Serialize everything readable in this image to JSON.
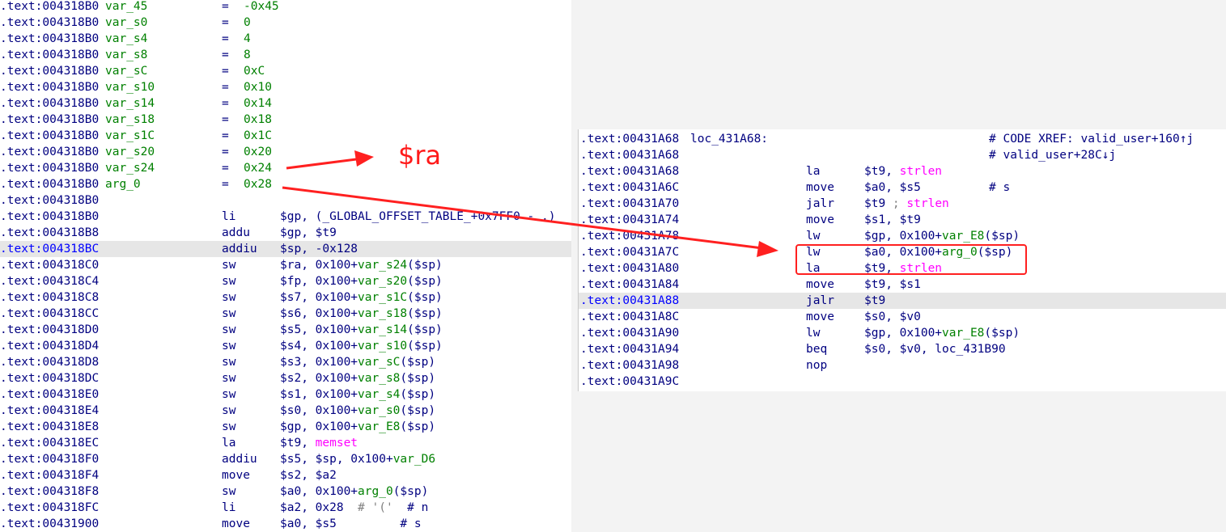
{
  "left": {
    "vars": [
      {
        "addr": ".text:004318B0",
        "name": "var_45",
        "eq": "=",
        "val": "-0x45"
      },
      {
        "addr": ".text:004318B0",
        "name": "var_s0",
        "eq": "=",
        "val": "0"
      },
      {
        "addr": ".text:004318B0",
        "name": "var_s4",
        "eq": "=",
        "val": "4"
      },
      {
        "addr": ".text:004318B0",
        "name": "var_s8",
        "eq": "=",
        "val": "8"
      },
      {
        "addr": ".text:004318B0",
        "name": "var_sC",
        "eq": "=",
        "val": "0xC"
      },
      {
        "addr": ".text:004318B0",
        "name": "var_s10",
        "eq": "=",
        "val": "0x10"
      },
      {
        "addr": ".text:004318B0",
        "name": "var_s14",
        "eq": "=",
        "val": "0x14"
      },
      {
        "addr": ".text:004318B0",
        "name": "var_s18",
        "eq": "=",
        "val": "0x18"
      },
      {
        "addr": ".text:004318B0",
        "name": "var_s1C",
        "eq": "=",
        "val": "0x1C"
      },
      {
        "addr": ".text:004318B0",
        "name": "var_s20",
        "eq": "=",
        "val": "0x20"
      },
      {
        "addr": ".text:004318B0",
        "name": "var_s24",
        "eq": "=",
        "val": "0x24"
      },
      {
        "addr": ".text:004318B0",
        "name": "arg_0",
        "eq": "=",
        "val": "0x28"
      }
    ],
    "blank_addr": ".text:004318B0",
    "code": [
      {
        "addr": ".text:004318B0",
        "mn": "li",
        "a": "$gp, ",
        "b": "(_GLOBAL_OFFSET_TABLE_+0x7FF0 - .)",
        "c": "",
        "b_cls": "navy"
      },
      {
        "addr": ".text:004318B8",
        "mn": "addu",
        "a": "$gp, $t9",
        "b": "",
        "c": ""
      },
      {
        "addr": ".text:004318BC",
        "mn": "addiu",
        "a": "$sp, -0x128",
        "b": "",
        "c": "",
        "hl": true
      },
      {
        "addr": ".text:004318C0",
        "mn": "sw",
        "a": "$ra, 0x100+",
        "b": "var_s24",
        "c": "($sp)"
      },
      {
        "addr": ".text:004318C4",
        "mn": "sw",
        "a": "$fp, 0x100+",
        "b": "var_s20",
        "c": "($sp)"
      },
      {
        "addr": ".text:004318C8",
        "mn": "sw",
        "a": "$s7, 0x100+",
        "b": "var_s1C",
        "c": "($sp)"
      },
      {
        "addr": ".text:004318CC",
        "mn": "sw",
        "a": "$s6, 0x100+",
        "b": "var_s18",
        "c": "($sp)"
      },
      {
        "addr": ".text:004318D0",
        "mn": "sw",
        "a": "$s5, 0x100+",
        "b": "var_s14",
        "c": "($sp)"
      },
      {
        "addr": ".text:004318D4",
        "mn": "sw",
        "a": "$s4, 0x100+",
        "b": "var_s10",
        "c": "($sp)"
      },
      {
        "addr": ".text:004318D8",
        "mn": "sw",
        "a": "$s3, 0x100+",
        "b": "var_sC",
        "c": "($sp)"
      },
      {
        "addr": ".text:004318DC",
        "mn": "sw",
        "a": "$s2, 0x100+",
        "b": "var_s8",
        "c": "($sp)"
      },
      {
        "addr": ".text:004318E0",
        "mn": "sw",
        "a": "$s1, 0x100+",
        "b": "var_s4",
        "c": "($sp)"
      },
      {
        "addr": ".text:004318E4",
        "mn": "sw",
        "a": "$s0, 0x100+",
        "b": "var_s0",
        "c": "($sp)"
      },
      {
        "addr": ".text:004318E8",
        "mn": "sw",
        "a": "$gp, 0x100+",
        "b": "var_E8",
        "c": "($sp)"
      },
      {
        "addr": ".text:004318EC",
        "mn": "la",
        "a": "$t9, ",
        "b": "memset",
        "c": "",
        "b_cls": "mag"
      },
      {
        "addr": ".text:004318F0",
        "mn": "addiu",
        "a": "$s5, $sp, 0x100+",
        "b": "var_D6",
        "c": ""
      },
      {
        "addr": ".text:004318F4",
        "mn": "move",
        "a": "$s2, $a2",
        "b": "",
        "c": ""
      },
      {
        "addr": ".text:004318F8",
        "mn": "sw",
        "a": "$a0, 0x100+",
        "b": "arg_0",
        "c": "($sp)"
      },
      {
        "addr": ".text:004318FC",
        "mn": "li",
        "a": "$a2, 0x28",
        "b": "  # '('",
        "c": "  # n",
        "b_cls": "gray",
        "c_cls": "navy"
      },
      {
        "addr": ".text:00431900",
        "mn": "move",
        "a": "$a0, $s5",
        "b": "",
        "c": "         # s",
        "c_cls": "navy"
      }
    ]
  },
  "right": {
    "label_row": {
      "addr": ".text:00431A68",
      "label": "loc_431A68:",
      "comment": "# CODE XREF: valid_user+160↑j"
    },
    "xref_row": {
      "addr": ".text:00431A68",
      "comment": "# valid_user+28C↓j"
    },
    "code": [
      {
        "addr": ".text:00431A68",
        "mn": "la",
        "a": "$t9, ",
        "b": "strlen",
        "c": "",
        "b_cls": "mag"
      },
      {
        "addr": ".text:00431A6C",
        "mn": "move",
        "a": "$a0, $s5",
        "b": "",
        "c": "# s",
        "c_cls": "navy",
        "c_col": true
      },
      {
        "addr": ".text:00431A70",
        "mn": "jalr",
        "a": "$t9",
        "b": " ; ",
        "c": "strlen",
        "b_cls": "gray",
        "c_cls": "mag"
      },
      {
        "addr": ".text:00431A74",
        "mn": "move",
        "a": "$s1, $t9",
        "b": "",
        "c": ""
      },
      {
        "addr": ".text:00431A78",
        "mn": "lw",
        "a": "$gp, 0x100+",
        "b": "var_E8",
        "c": "($sp)"
      },
      {
        "addr": ".text:00431A7C",
        "mn": "lw",
        "a": "$a0, 0x100+",
        "b": "arg_0",
        "c": "($sp)"
      },
      {
        "addr": ".text:00431A80",
        "mn": "la",
        "a": "$t9, ",
        "b": "strlen",
        "c": "",
        "b_cls": "mag"
      },
      {
        "addr": ".text:00431A84",
        "mn": "move",
        "a": "$t9, $s1",
        "b": "",
        "c": ""
      },
      {
        "addr": ".text:00431A88",
        "mn": "jalr",
        "a": "$t9",
        "b": "",
        "c": "",
        "hl": true
      },
      {
        "addr": ".text:00431A8C",
        "mn": "move",
        "a": "$s0, $v0",
        "b": "",
        "c": ""
      },
      {
        "addr": ".text:00431A90",
        "mn": "lw",
        "a": "$gp, 0x100+",
        "b": "var_E8",
        "c": "($sp)"
      },
      {
        "addr": ".text:00431A94",
        "mn": "beq",
        "a": "$s0, $v0, loc_431B90",
        "b": "",
        "c": ""
      },
      {
        "addr": ".text:00431A98",
        "mn": "nop",
        "a": "",
        "b": "",
        "c": ""
      }
    ],
    "tail_addr": ".text:00431A9C"
  },
  "annotation": {
    "text": "$ra",
    "color": "#ff1a1a"
  },
  "colors": {
    "address": "#000080",
    "variable": "#008000",
    "import": "#ff00ff",
    "highlight": "#e6e6e6",
    "annotation": "#ff2020"
  }
}
